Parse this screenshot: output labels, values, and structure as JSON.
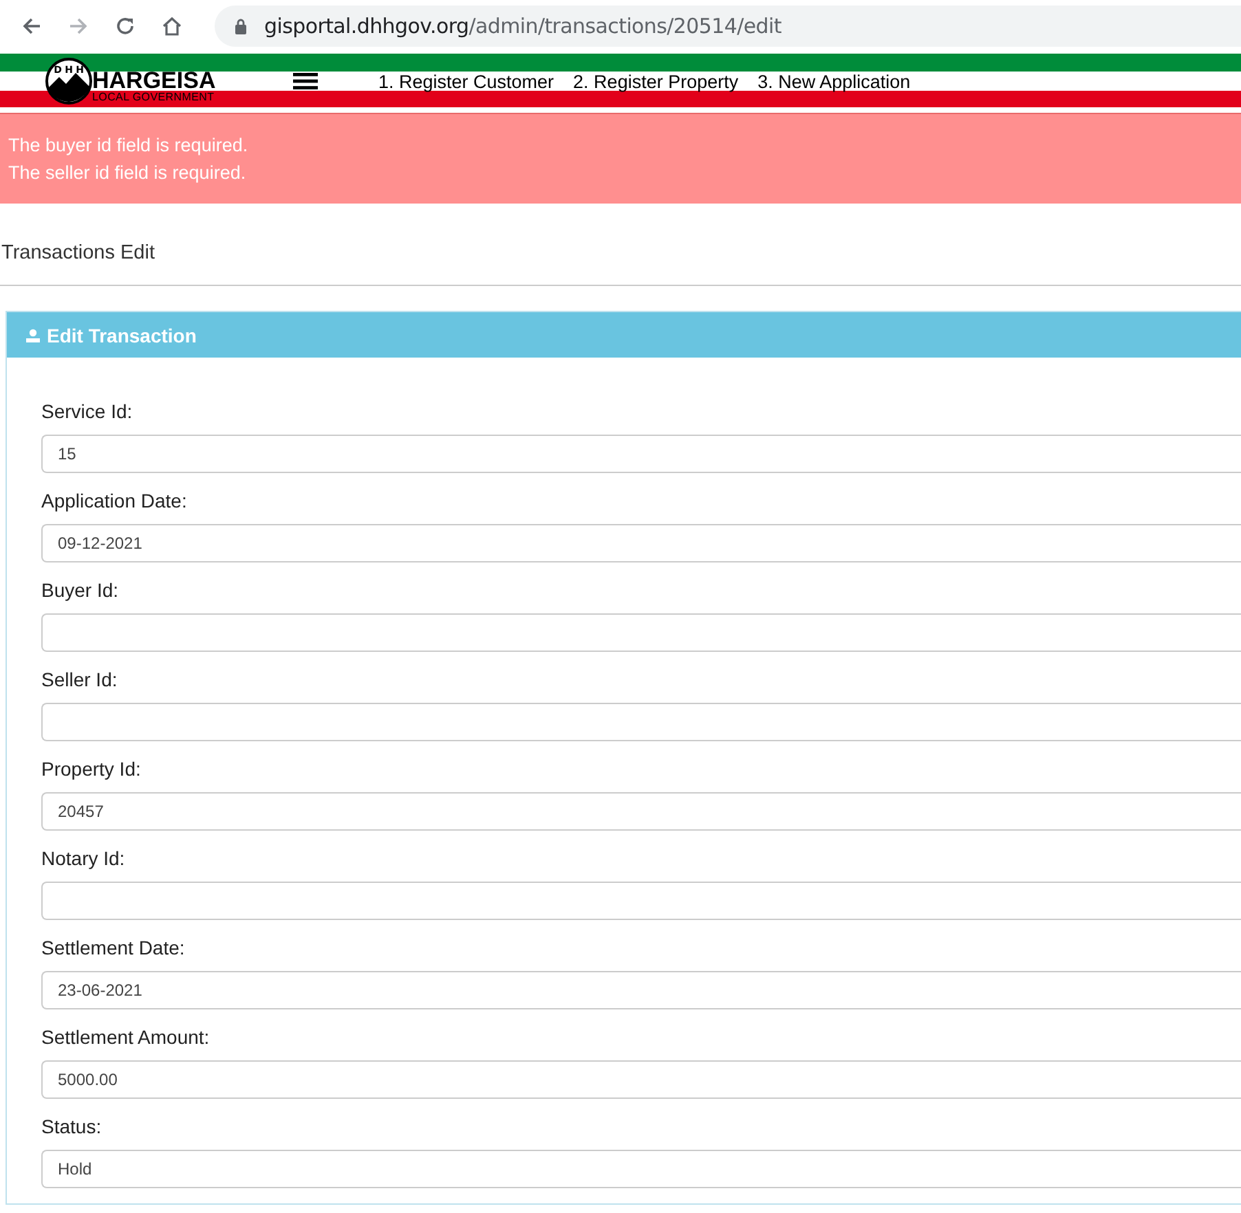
{
  "browser": {
    "url_host": "gisportal.dhhgov.org",
    "url_path": "/admin/transactions/20514/edit"
  },
  "header": {
    "logo_letters": [
      "D",
      "H",
      "H"
    ],
    "logo_name": "HARGEISA",
    "logo_subtitle": "LOCAL GOVERNMENT",
    "nav": [
      "1. Register Customer",
      "2. Register Property",
      "3. New Application"
    ]
  },
  "errors": [
    "The buyer id field is required.",
    "The seller id field is required."
  ],
  "page_title": "Transactions Edit",
  "panel": {
    "title": "Edit Transaction",
    "fields": [
      {
        "label": "Service Id:",
        "value": "15"
      },
      {
        "label": "Application Date:",
        "value": "09-12-2021"
      },
      {
        "label": "Buyer Id:"
      },
      {
        "label": "Seller Id:"
      },
      {
        "label": "Property Id:",
        "value": "20457"
      },
      {
        "label": "Notary Id:"
      },
      {
        "label": "Settlement Date:",
        "value": "23-06-2021"
      },
      {
        "label": "Settlement Amount:",
        "value": "5000.00"
      },
      {
        "label": "Status:",
        "value": "Hold"
      }
    ]
  }
}
